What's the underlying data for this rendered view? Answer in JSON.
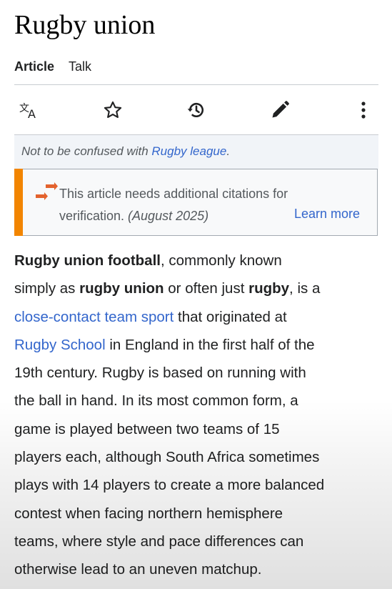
{
  "page": {
    "title": "Rugby union"
  },
  "tabs": [
    {
      "label": "Article",
      "selected": true
    },
    {
      "label": "Talk",
      "selected": false
    }
  ],
  "toolbar": {
    "icons": [
      "translate-icon",
      "star-icon",
      "history-icon",
      "edit-pencil-icon",
      "more-vertical-icon"
    ]
  },
  "hatnote": {
    "prefix": "Not to be confused with ",
    "link": "Rugby league",
    "suffix": "."
  },
  "notice": {
    "line1": "This article needs additional citations for",
    "line2_text": "verification. ",
    "date": "(August 2025)",
    "learn_more": "Learn more",
    "accent_color": "#f28500"
  },
  "article": {
    "l1_bold": "Rugby union football",
    "l1_rest": ", commonly known",
    "l2_pre": "simply as ",
    "l2_bold1": "rugby union",
    "l2_mid": " or often just ",
    "l2_bold2": "rugby",
    "l2_post": ", is a",
    "l3_link": "close-contact team sport",
    "l3_rest": " that originated at",
    "l4_link": "Rugby School",
    "l4_rest": " in England in the first half of the",
    "lines": [
      "19th century. Rugby is based on running with",
      "the ball in hand. In its most common form, a",
      "game is played between two teams of 15",
      "players each, although South Africa sometimes",
      "plays with 14 players to create a more balanced",
      "contest when facing northern hemisphere",
      "teams, where style and pace differences can",
      "otherwise lead to an uneven matchup."
    ]
  },
  "colors": {
    "link": "#3366cc",
    "text": "#202122"
  }
}
